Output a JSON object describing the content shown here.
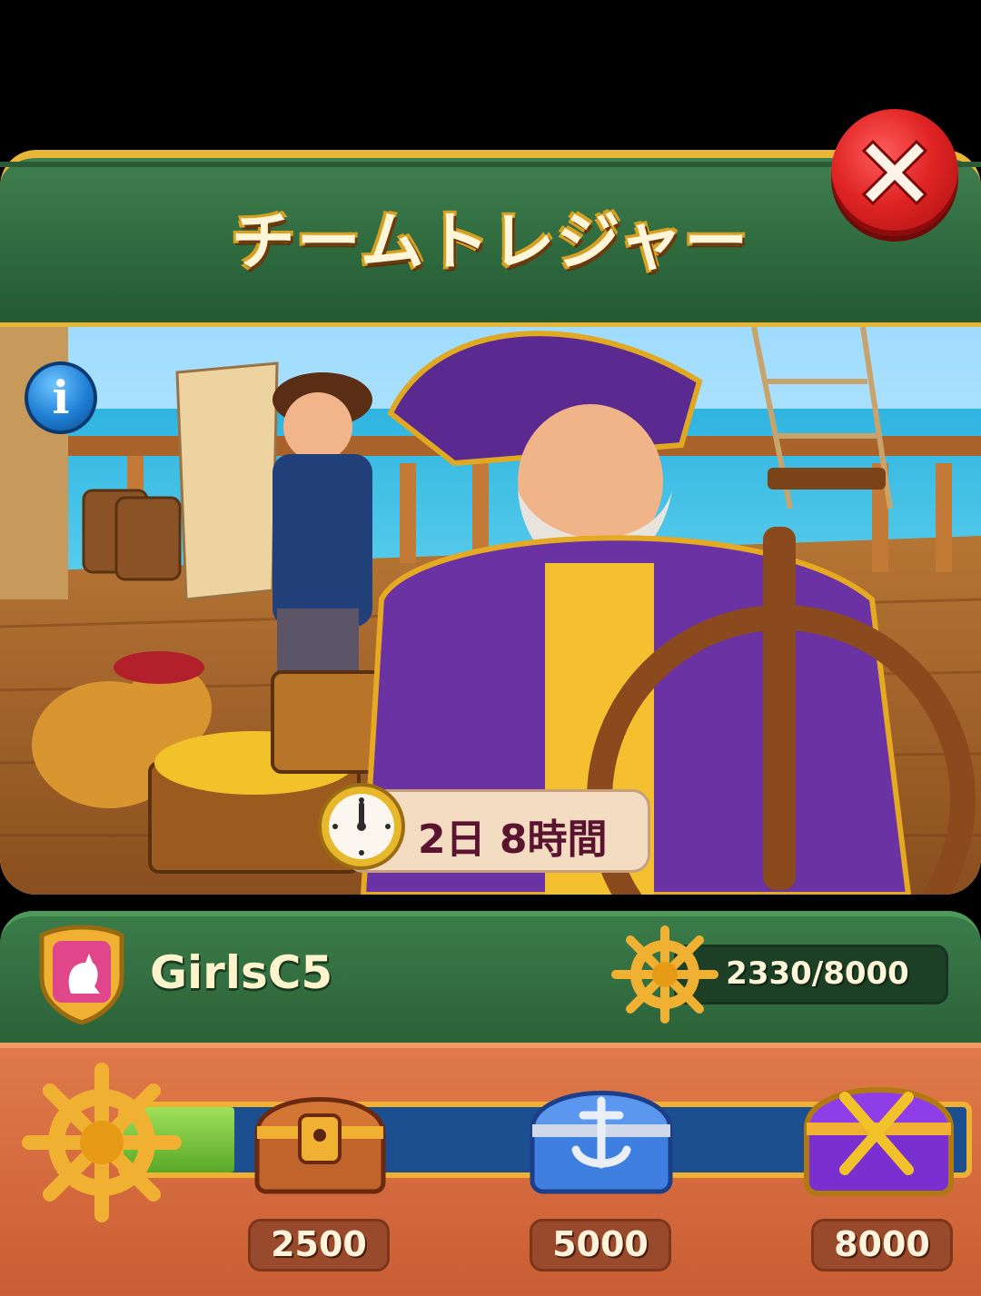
{
  "header": {
    "title": "チームトレジャー"
  },
  "event": {
    "time_remaining": "2日 8時間"
  },
  "team": {
    "name": "GirlsC5",
    "score": "2330/8000"
  },
  "progress": {
    "current": 2330,
    "max": 8000,
    "milestones": [
      {
        "value": "2500",
        "chest": "brown-chest-icon"
      },
      {
        "value": "5000",
        "chest": "blue-anchor-chest-icon"
      },
      {
        "value": "8000",
        "chest": "purple-swords-chest-icon"
      }
    ]
  },
  "colors": {
    "banner_green": "#2f6a3f",
    "gold": "#e9b735",
    "close_red": "#e02424",
    "progress_blue": "#1c4f8f",
    "progress_green": "#58a827",
    "orange_panel": "#d8693d"
  }
}
